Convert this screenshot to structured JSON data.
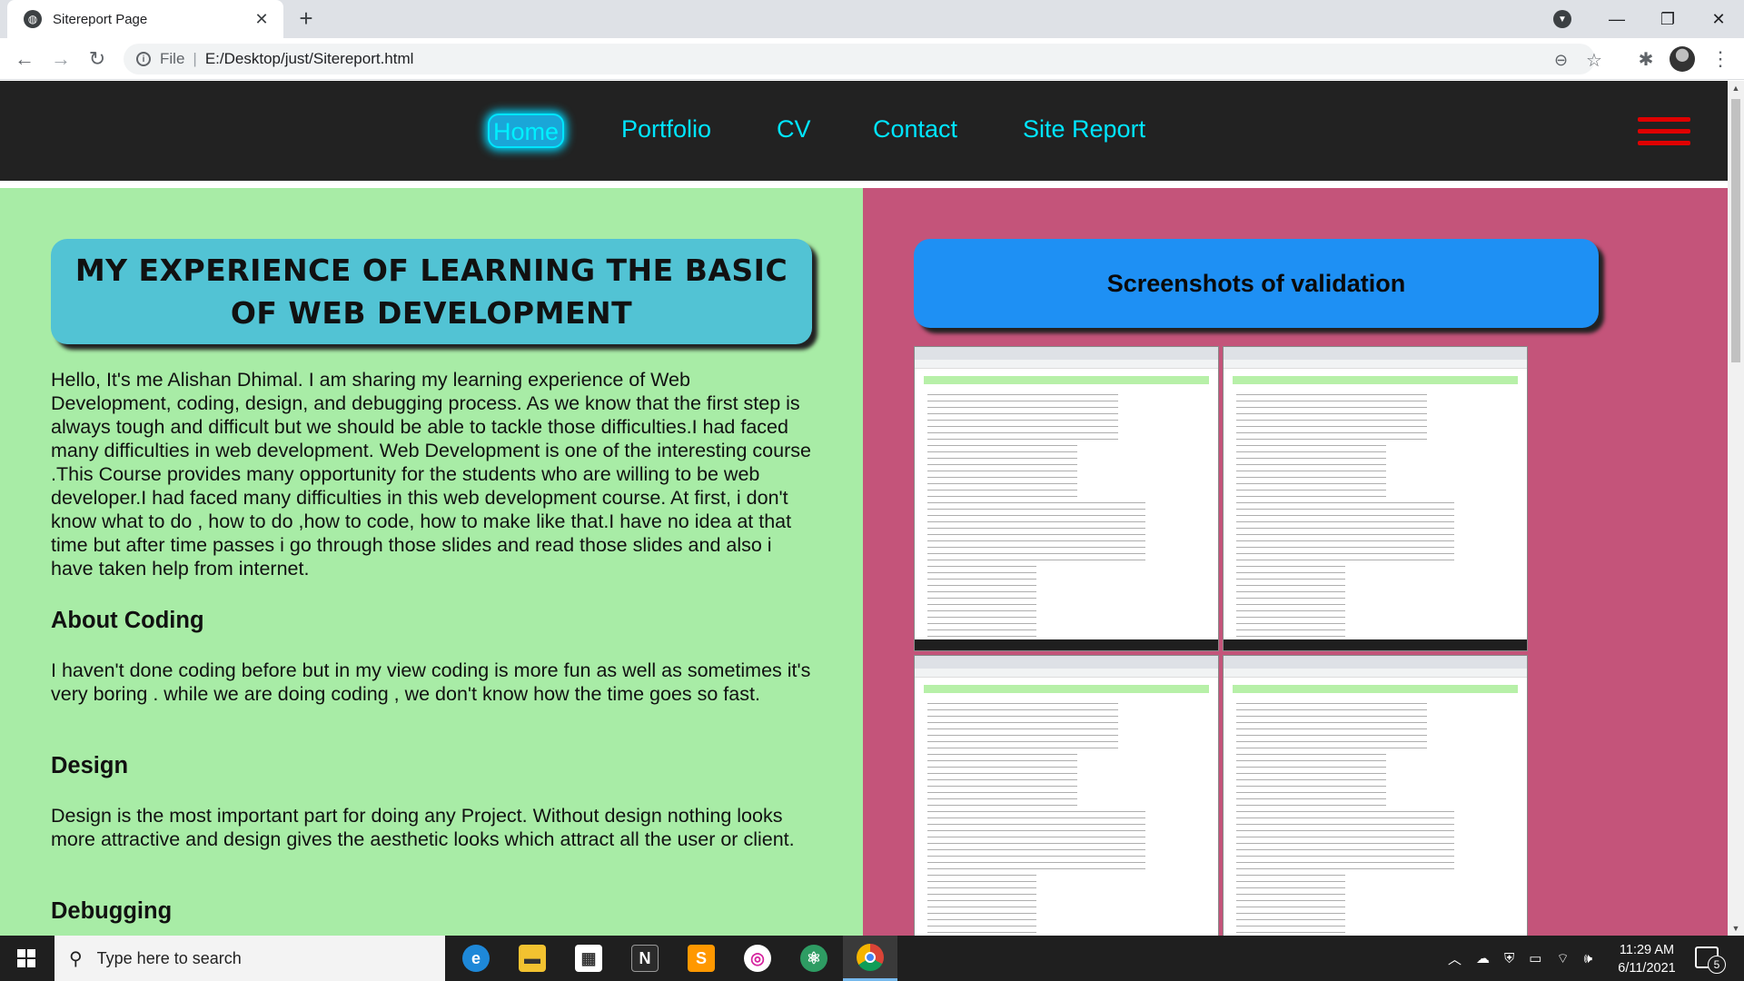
{
  "browser": {
    "tab_title": "Sitereport Page",
    "tab_close": "✕",
    "new_tab": "+",
    "file_label": "File",
    "separator": "|",
    "url": "E:/Desktop/just/Sitereport.html"
  },
  "site_nav": {
    "links": [
      "Home",
      "Portfolio",
      "CV",
      "Contact",
      "Site Report"
    ],
    "active": "Home",
    "accent_color": "#00e5ff",
    "hamburger_color": "#e00000"
  },
  "left": {
    "heading": "MY EXPERIENCE OF LEARNING THE BASIC OF WEB DEVELOPMENT",
    "intro": "Hello, It's me Alishan Dhimal. I am sharing my learning experience of Web Development, coding, design, and debugging process. As we know that the first step is always tough and difficult but we should be able to tackle those difficulties.I had faced many difficulties in web development. Web Development is one of the interesting course .This Course provides many opportunity for the students who are willing to be web developer.I had faced many difficulties in this web development course. At first, i don't know what to do , how to do ,how to code, how to make like that.I have no idea at that time but after time passes i go through those slides and read those slides and also i have taken help from internet.",
    "sections": [
      {
        "title": "About Coding",
        "text": "I haven't done coding before but in my view coding is more fun as well as sometimes it's very boring . while we are doing coding , we don't know how the time goes so fast."
      },
      {
        "title": "Design",
        "text": "Design is the most important part for doing any Project. Without design nothing looks more attractive and design gives the aesthetic looks which attract all the user or client."
      },
      {
        "title": "Debugging",
        "text": ""
      }
    ],
    "bg_color": "#a8eca6"
  },
  "right": {
    "heading": "Screenshots of validation",
    "bg_color": "#c4547a",
    "button_color": "#1e90f4"
  },
  "taskbar": {
    "search_placeholder": "Type here to search",
    "time": "11:29 AM",
    "date": "6/11/2021",
    "notification_count": "5"
  },
  "icons": {
    "back": "arrow-left-icon",
    "forward": "arrow-right-icon",
    "reload": "reload-icon",
    "zoom": "zoom-out-icon",
    "bookmark": "star-icon",
    "extensions": "puzzle-icon",
    "menu": "kebab-menu-icon"
  }
}
